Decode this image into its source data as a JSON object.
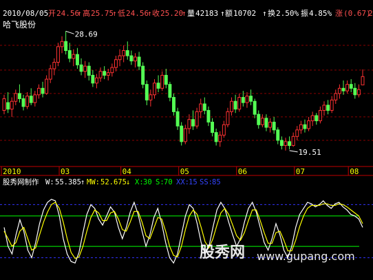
{
  "stock": {
    "name": "哈飞股份",
    "date": "2010/08/05",
    "open_label": "开",
    "open": "24.56",
    "high_label": "高",
    "high": "25.75",
    "low_label": "低",
    "low": "24.56",
    "close_label": "收",
    "close": "25.20",
    "vol_label": "量",
    "vol": "42183",
    "amount_label": "额",
    "amount": "10702",
    "turnover_label": "换",
    "turnover": "2.50%",
    "amplitude_label": "振",
    "amplitude": "4.85%",
    "change_label": "涨",
    "change": "(0.67)",
    "change_pct": "2"
  },
  "indicator": {
    "name": "股秀网制作",
    "w_label": "W:",
    "w": "55.385",
    "mw_label": "MW:",
    "mw": "52.675",
    "x_label": "X:",
    "x": "30",
    "s_label": "S:",
    "s": "70",
    "xx_label": "XX:",
    "xx": "15",
    "ss_label": "SS:",
    "ss": "85"
  },
  "watermark": {
    "text": "股秀网",
    "url": "www.gupang.com"
  },
  "colors": {
    "bg": "#000000",
    "up": "#ff3232",
    "down": "#54ff54",
    "axis": "#c00000",
    "grid": "#8a0000",
    "text_up": "#ff5050",
    "white": "#ffffff",
    "line_green": "#00ff00",
    "line_yellow": "#ffff00",
    "dash_blue": "#3333ff"
  },
  "chart_data": [
    {
      "type": "candlestick",
      "x_ticks": [
        "2010",
        "03",
        "04",
        "05",
        "06",
        "07",
        "08"
      ],
      "x_tick_positions": [
        0,
        15,
        31,
        46,
        61,
        76,
        90
      ],
      "ylim": [
        18.5,
        29.5
      ],
      "gridlines": [
        27.6,
        25.7,
        23.9,
        22.1,
        20.3
      ],
      "annotations": [
        {
          "text": "28.69",
          "index": 16,
          "value": 28.69
        },
        {
          "text": "19.51",
          "index": 74,
          "value": 19.51
        }
      ],
      "candles": [
        {
          "o": 22.6,
          "h": 23.8,
          "l": 22.3,
          "c": 23.5
        },
        {
          "o": 23.2,
          "h": 24.0,
          "l": 22.4,
          "c": 22.7
        },
        {
          "o": 22.7,
          "h": 23.6,
          "l": 22.1,
          "c": 23.3
        },
        {
          "o": 23.3,
          "h": 24.2,
          "l": 23.0,
          "c": 23.9
        },
        {
          "o": 23.9,
          "h": 24.6,
          "l": 23.2,
          "c": 23.5
        },
        {
          "o": 23.5,
          "h": 23.8,
          "l": 22.6,
          "c": 22.9
        },
        {
          "o": 22.9,
          "h": 24.0,
          "l": 22.7,
          "c": 23.7
        },
        {
          "o": 23.7,
          "h": 24.3,
          "l": 23.0,
          "c": 23.2
        },
        {
          "o": 23.2,
          "h": 24.1,
          "l": 22.9,
          "c": 23.8
        },
        {
          "o": 23.8,
          "h": 24.6,
          "l": 23.5,
          "c": 24.3
        },
        {
          "o": 24.3,
          "h": 24.8,
          "l": 23.6,
          "c": 23.9
        },
        {
          "o": 23.9,
          "h": 25.3,
          "l": 23.8,
          "c": 25.0
        },
        {
          "o": 25.0,
          "h": 26.1,
          "l": 24.7,
          "c": 25.8
        },
        {
          "o": 25.8,
          "h": 26.6,
          "l": 25.3,
          "c": 26.3
        },
        {
          "o": 26.3,
          "h": 27.8,
          "l": 26.0,
          "c": 27.5
        },
        {
          "o": 27.5,
          "h": 28.3,
          "l": 27.0,
          "c": 27.9
        },
        {
          "o": 27.9,
          "h": 28.69,
          "l": 26.9,
          "c": 27.2
        },
        {
          "o": 27.2,
          "h": 27.8,
          "l": 26.3,
          "c": 26.6
        },
        {
          "o": 26.6,
          "h": 27.3,
          "l": 26.0,
          "c": 26.9
        },
        {
          "o": 26.9,
          "h": 27.4,
          "l": 25.8,
          "c": 26.1
        },
        {
          "o": 26.1,
          "h": 26.6,
          "l": 25.3,
          "c": 25.6
        },
        {
          "o": 25.6,
          "h": 26.4,
          "l": 25.1,
          "c": 26.0
        },
        {
          "o": 26.0,
          "h": 26.3,
          "l": 24.9,
          "c": 25.3
        },
        {
          "o": 25.3,
          "h": 25.7,
          "l": 24.4,
          "c": 24.7
        },
        {
          "o": 24.7,
          "h": 25.4,
          "l": 24.3,
          "c": 25.1
        },
        {
          "o": 25.1,
          "h": 25.9,
          "l": 24.8,
          "c": 25.6
        },
        {
          "o": 25.6,
          "h": 26.0,
          "l": 25.0,
          "c": 25.3
        },
        {
          "o": 25.3,
          "h": 25.8,
          "l": 24.9,
          "c": 25.5
        },
        {
          "o": 25.5,
          "h": 26.2,
          "l": 25.2,
          "c": 25.9
        },
        {
          "o": 25.9,
          "h": 26.8,
          "l": 25.6,
          "c": 26.5
        },
        {
          "o": 26.5,
          "h": 27.3,
          "l": 26.0,
          "c": 26.8
        },
        {
          "o": 26.8,
          "h": 27.6,
          "l": 26.3,
          "c": 27.2
        },
        {
          "o": 27.2,
          "h": 27.9,
          "l": 26.5,
          "c": 26.8
        },
        {
          "o": 26.8,
          "h": 27.2,
          "l": 26.1,
          "c": 26.4
        },
        {
          "o": 26.4,
          "h": 27.0,
          "l": 25.9,
          "c": 26.7
        },
        {
          "o": 26.7,
          "h": 27.1,
          "l": 25.7,
          "c": 26.0
        },
        {
          "o": 26.0,
          "h": 26.3,
          "l": 24.3,
          "c": 24.6
        },
        {
          "o": 24.6,
          "h": 24.9,
          "l": 23.0,
          "c": 23.4
        },
        {
          "o": 23.4,
          "h": 24.2,
          "l": 22.9,
          "c": 23.8
        },
        {
          "o": 23.8,
          "h": 25.0,
          "l": 23.5,
          "c": 24.7
        },
        {
          "o": 24.7,
          "h": 25.3,
          "l": 24.0,
          "c": 24.3
        },
        {
          "o": 24.3,
          "h": 25.6,
          "l": 24.1,
          "c": 25.3
        },
        {
          "o": 25.3,
          "h": 25.8,
          "l": 24.3,
          "c": 24.6
        },
        {
          "o": 24.6,
          "h": 24.8,
          "l": 23.3,
          "c": 23.6
        },
        {
          "o": 23.6,
          "h": 23.9,
          "l": 22.2,
          "c": 22.5
        },
        {
          "o": 22.5,
          "h": 22.8,
          "l": 21.1,
          "c": 21.4
        },
        {
          "o": 21.4,
          "h": 21.7,
          "l": 19.9,
          "c": 20.2
        },
        {
          "o": 20.2,
          "h": 21.5,
          "l": 20.0,
          "c": 21.2
        },
        {
          "o": 21.2,
          "h": 22.3,
          "l": 20.8,
          "c": 21.9
        },
        {
          "o": 21.9,
          "h": 22.6,
          "l": 21.1,
          "c": 21.4
        },
        {
          "o": 21.4,
          "h": 22.8,
          "l": 21.2,
          "c": 22.5
        },
        {
          "o": 22.5,
          "h": 23.5,
          "l": 22.0,
          "c": 23.1
        },
        {
          "o": 23.1,
          "h": 23.6,
          "l": 22.3,
          "c": 22.6
        },
        {
          "o": 22.6,
          "h": 22.9,
          "l": 21.4,
          "c": 21.7
        },
        {
          "o": 21.7,
          "h": 22.0,
          "l": 20.6,
          "c": 20.9
        },
        {
          "o": 20.9,
          "h": 21.2,
          "l": 19.9,
          "c": 20.2
        },
        {
          "o": 20.2,
          "h": 21.0,
          "l": 19.8,
          "c": 20.7
        },
        {
          "o": 20.7,
          "h": 21.8,
          "l": 20.5,
          "c": 21.5
        },
        {
          "o": 21.5,
          "h": 22.8,
          "l": 21.3,
          "c": 22.5
        },
        {
          "o": 22.5,
          "h": 23.6,
          "l": 22.2,
          "c": 23.3
        },
        {
          "o": 23.3,
          "h": 23.8,
          "l": 22.4,
          "c": 22.7
        },
        {
          "o": 22.7,
          "h": 23.9,
          "l": 22.5,
          "c": 23.6
        },
        {
          "o": 23.6,
          "h": 24.1,
          "l": 22.9,
          "c": 23.2
        },
        {
          "o": 23.2,
          "h": 24.0,
          "l": 22.8,
          "c": 23.7
        },
        {
          "o": 23.7,
          "h": 24.2,
          "l": 23.0,
          "c": 23.3
        },
        {
          "o": 23.3,
          "h": 23.5,
          "l": 22.0,
          "c": 22.3
        },
        {
          "o": 22.3,
          "h": 22.6,
          "l": 21.2,
          "c": 21.5
        },
        {
          "o": 21.5,
          "h": 22.3,
          "l": 21.3,
          "c": 22.0
        },
        {
          "o": 22.0,
          "h": 22.3,
          "l": 21.0,
          "c": 21.3
        },
        {
          "o": 21.3,
          "h": 22.0,
          "l": 20.9,
          "c": 21.7
        },
        {
          "o": 21.7,
          "h": 22.1,
          "l": 20.8,
          "c": 21.1
        },
        {
          "o": 21.1,
          "h": 21.3,
          "l": 20.0,
          "c": 20.3
        },
        {
          "o": 20.3,
          "h": 20.6,
          "l": 19.6,
          "c": 19.9
        },
        {
          "o": 19.9,
          "h": 20.5,
          "l": 19.51,
          "c": 20.2
        },
        {
          "o": 20.2,
          "h": 20.6,
          "l": 19.6,
          "c": 19.9
        },
        {
          "o": 19.9,
          "h": 20.9,
          "l": 19.8,
          "c": 20.6
        },
        {
          "o": 20.6,
          "h": 21.4,
          "l": 20.3,
          "c": 21.1
        },
        {
          "o": 21.1,
          "h": 21.8,
          "l": 20.8,
          "c": 21.5
        },
        {
          "o": 21.5,
          "h": 21.9,
          "l": 20.9,
          "c": 21.2
        },
        {
          "o": 21.2,
          "h": 22.1,
          "l": 21.0,
          "c": 21.8
        },
        {
          "o": 21.8,
          "h": 22.5,
          "l": 21.4,
          "c": 22.2
        },
        {
          "o": 22.2,
          "h": 22.4,
          "l": 21.5,
          "c": 21.8
        },
        {
          "o": 21.8,
          "h": 22.9,
          "l": 21.6,
          "c": 22.6
        },
        {
          "o": 22.6,
          "h": 23.3,
          "l": 22.2,
          "c": 23.0
        },
        {
          "o": 23.0,
          "h": 23.4,
          "l": 22.3,
          "c": 22.6
        },
        {
          "o": 22.6,
          "h": 23.7,
          "l": 22.4,
          "c": 23.4
        },
        {
          "o": 23.4,
          "h": 24.2,
          "l": 23.1,
          "c": 23.9
        },
        {
          "o": 23.9,
          "h": 24.6,
          "l": 23.5,
          "c": 24.3
        },
        {
          "o": 24.3,
          "h": 24.9,
          "l": 23.8,
          "c": 24.1
        },
        {
          "o": 24.1,
          "h": 24.9,
          "l": 23.9,
          "c": 24.6
        },
        {
          "o": 24.6,
          "h": 25.0,
          "l": 24.0,
          "c": 24.3
        },
        {
          "o": 24.3,
          "h": 24.7,
          "l": 23.5,
          "c": 23.8
        },
        {
          "o": 23.8,
          "h": 24.6,
          "l": 23.6,
          "c": 24.2
        },
        {
          "o": 24.56,
          "h": 25.75,
          "l": 24.56,
          "c": 25.2
        }
      ]
    },
    {
      "type": "line",
      "name_ref": "indicator",
      "ylim": [
        -8,
        108
      ],
      "levels": [
        {
          "value": 70,
          "style": "solid"
        },
        {
          "value": 30,
          "style": "solid"
        },
        {
          "value": 85,
          "style": "dash"
        },
        {
          "value": 15,
          "style": "dash"
        }
      ],
      "series": [
        {
          "name": "W",
          "values": [
            55,
            30,
            20,
            45,
            65,
            50,
            25,
            15,
            35,
            60,
            78,
            88,
            92,
            90,
            70,
            40,
            20,
            10,
            8,
            22,
            48,
            72,
            85,
            80,
            66,
            58,
            70,
            82,
            75,
            55,
            40,
            55,
            75,
            88,
            72,
            50,
            30,
            45,
            68,
            80,
            60,
            35,
            15,
            8,
            20,
            45,
            70,
            85,
            80,
            60,
            35,
            20,
            30,
            55,
            78,
            88,
            80,
            62,
            45,
            30,
            40,
            62,
            80,
            88,
            75,
            55,
            35,
            25,
            40,
            60,
            45,
            25,
            15,
            30,
            55,
            72,
            80,
            88,
            86,
            82,
            85,
            90,
            84,
            80,
            86,
            88,
            82,
            78,
            72,
            70,
            66,
            55
          ]
        },
        {
          "name": "MW",
          "values": [
            50,
            40,
            30,
            35,
            50,
            55,
            40,
            25,
            28,
            45,
            62,
            75,
            85,
            88,
            80,
            62,
            40,
            22,
            14,
            16,
            30,
            50,
            68,
            78,
            74,
            64,
            64,
            74,
            76,
            66,
            52,
            50,
            62,
            76,
            76,
            62,
            44,
            40,
            54,
            68,
            66,
            50,
            30,
            18,
            16,
            30,
            52,
            70,
            78,
            72,
            55,
            36,
            28,
            40,
            58,
            74,
            80,
            72,
            58,
            44,
            38,
            48,
            64,
            78,
            78,
            64,
            48,
            34,
            34,
            48,
            50,
            38,
            24,
            24,
            38,
            56,
            70,
            80,
            84,
            84,
            84,
            86,
            86,
            84,
            84,
            86,
            85,
            82,
            78,
            74,
            70,
            60
          ]
        }
      ]
    }
  ]
}
